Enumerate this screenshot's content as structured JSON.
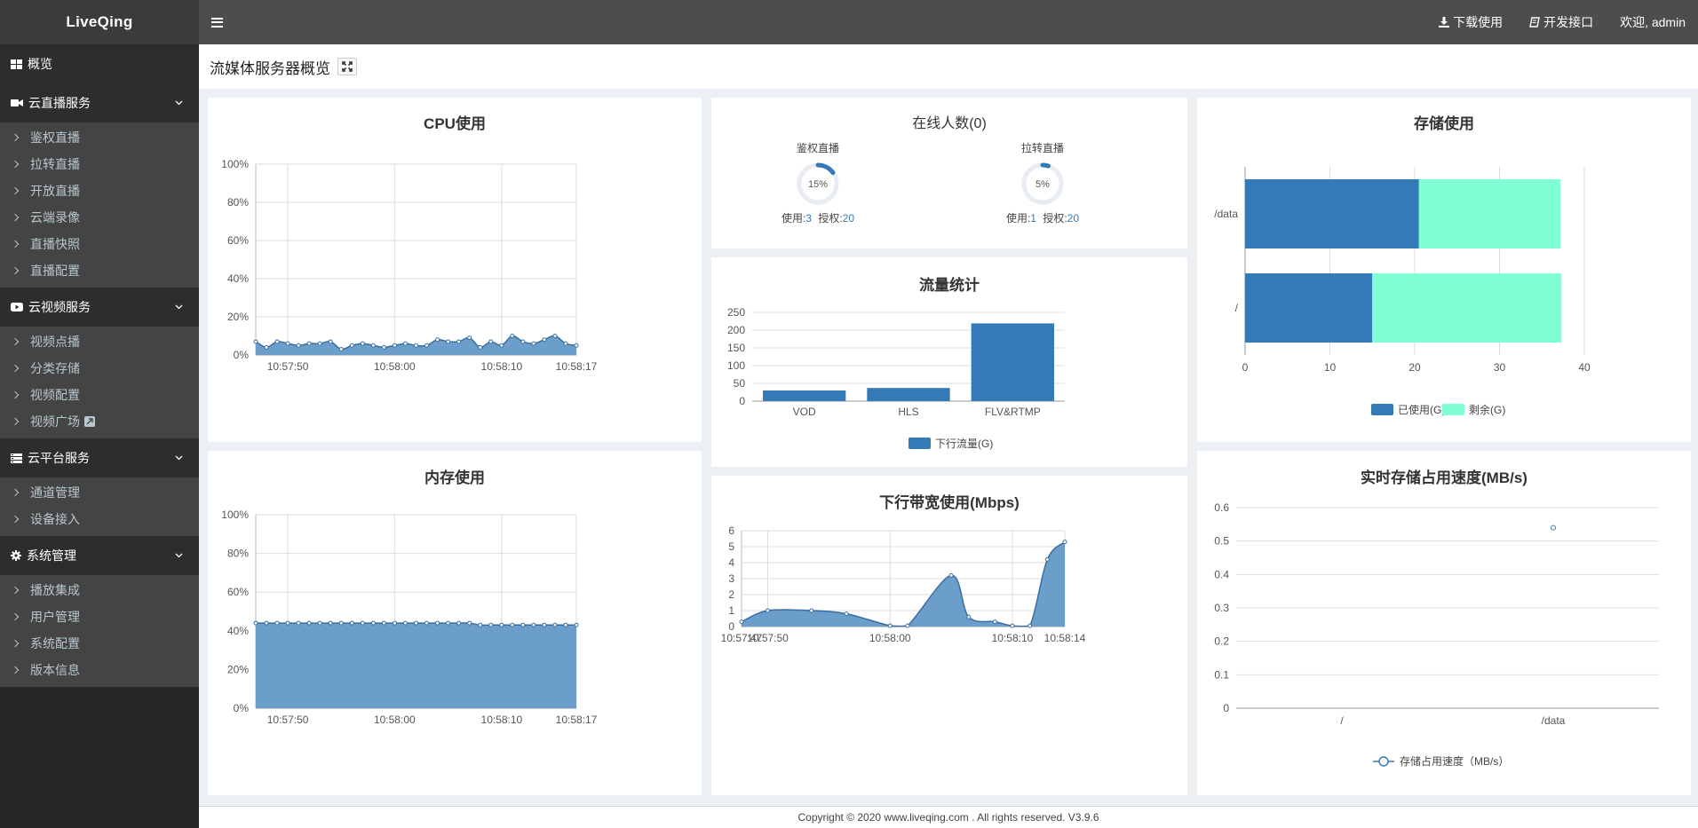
{
  "app": {
    "logo": "LiveQing"
  },
  "header": {
    "download_label": "下载使用",
    "api_label": "开发接口",
    "welcome": "欢迎, admin"
  },
  "sidebar": {
    "overview": "概览",
    "groups": [
      {
        "label": "云直播服务",
        "icon": "video-camera-icon",
        "items": [
          "鉴权直播",
          "拉转直播",
          "开放直播",
          "云端录像",
          "直播快照",
          "直播配置"
        ]
      },
      {
        "label": "云视频服务",
        "icon": "youtube-play-icon",
        "items": [
          "视频点播",
          "分类存储",
          "视频配置",
          "视频广场"
        ]
      },
      {
        "label": "云平台服务",
        "icon": "server-icon",
        "items": [
          "通道管理",
          "设备接入"
        ]
      },
      {
        "label": "系统管理",
        "icon": "gear-icon",
        "items": [
          "播放集成",
          "用户管理",
          "系统配置",
          "版本信息"
        ]
      }
    ]
  },
  "page": {
    "title": "流媒体服务器概览"
  },
  "panels": {
    "cpu": {
      "title": "CPU使用"
    },
    "online": {
      "title": "在线人数(0)",
      "auth": {
        "label": "鉴权直播",
        "percent": "15%",
        "used_label": "使用:",
        "used": "3",
        "licensed_label": "授权:",
        "licensed": "20"
      },
      "pull": {
        "label": "拉转直播",
        "percent": "5%",
        "used_label": "使用:",
        "used": "1",
        "licensed_label": "授权:",
        "licensed": "20"
      }
    },
    "storage": {
      "title": "存储使用"
    },
    "traffic": {
      "title": "流量统计"
    },
    "memory": {
      "title": "内存使用"
    },
    "bandwidth": {
      "title": "下行带宽使用(Mbps)"
    },
    "speed": {
      "title": "实时存储占用速度(MB/s)"
    }
  },
  "colors": {
    "blue": "#337ab7",
    "area": "#6b9ecb",
    "mint": "#7fffd4"
  },
  "chart_data": [
    {
      "id": "cpu",
      "type": "area",
      "x_ticks": [
        "10:57:50",
        "10:58:00",
        "10:58:10",
        "10:58:17"
      ],
      "y_ticks": [
        "100%",
        "80%",
        "60%",
        "40%",
        "20%",
        "0%"
      ],
      "ylim": [
        0,
        100
      ],
      "values": [
        7,
        4,
        7,
        6,
        5,
        6,
        6,
        7,
        3,
        5,
        6,
        5,
        4,
        5,
        6,
        5,
        5,
        8,
        7,
        7,
        9,
        4,
        7,
        5,
        10,
        7,
        6,
        8,
        10,
        6,
        5
      ]
    },
    {
      "id": "memory",
      "type": "area",
      "x_ticks": [
        "10:57:50",
        "10:58:00",
        "10:58:10",
        "10:58:17"
      ],
      "y_ticks": [
        "100%",
        "80%",
        "60%",
        "40%",
        "20%",
        "0%"
      ],
      "ylim": [
        0,
        100
      ],
      "values": [
        44,
        44,
        44,
        44,
        44,
        44,
        44,
        44,
        44,
        44,
        44,
        44,
        44,
        44,
        44,
        44,
        44,
        44,
        44,
        44,
        44,
        43,
        43,
        43,
        43,
        43,
        43,
        43,
        43,
        43,
        43
      ]
    },
    {
      "id": "storage",
      "type": "bar",
      "orientation": "horizontal",
      "stacked": true,
      "categories": [
        "/data",
        "/"
      ],
      "series": [
        {
          "name": "已使用(G)",
          "values": [
            20.5,
            15
          ]
        },
        {
          "name": "剩余(G)",
          "values": [
            16.7,
            22.3
          ]
        }
      ],
      "x_ticks": [
        "0",
        "10",
        "20",
        "30",
        "40"
      ],
      "xlim": [
        0,
        40
      ],
      "legend": "bottom"
    },
    {
      "id": "traffic",
      "type": "bar",
      "categories": [
        "VOD",
        "HLS",
        "FLV&RTMP"
      ],
      "series": [
        {
          "name": "下行流量(G)",
          "values": [
            30,
            37,
            219
          ]
        }
      ],
      "y_ticks": [
        "250",
        "200",
        "150",
        "100",
        "50",
        "0"
      ],
      "ylim": [
        0,
        250
      ],
      "legend": "bottom"
    },
    {
      "id": "bandwidth",
      "type": "area",
      "x_ticks": [
        "10:57:47",
        "10:57:50",
        "10:58:00",
        "10:58:10",
        "10:58:14"
      ],
      "y_ticks": [
        "6",
        "5",
        "4",
        "3",
        "2",
        "1",
        "0"
      ],
      "ylim": [
        0,
        6
      ],
      "x": [
        0,
        3,
        8,
        12,
        17,
        19,
        24,
        26,
        29,
        31,
        33,
        35,
        37
      ],
      "values": [
        0.3,
        1.0,
        1.0,
        0.8,
        0.05,
        0.05,
        3.2,
        0.6,
        0.3,
        0.05,
        0.05,
        4.2,
        5.3
      ]
    },
    {
      "id": "speed",
      "type": "scatter",
      "categories": [
        "/",
        "/data"
      ],
      "series": [
        {
          "name": "存储占用速度（MB/s）",
          "values": [
            null,
            0.54
          ]
        }
      ],
      "y_ticks": [
        "0.6",
        "0.5",
        "0.4",
        "0.3",
        "0.2",
        "0.1",
        "0"
      ],
      "ylim": [
        0,
        0.6
      ],
      "legend": "bottom"
    }
  ],
  "footer": {
    "text": "Copyright © 2020 www.liveqing.com . All rights reserved. V3.9.6"
  }
}
